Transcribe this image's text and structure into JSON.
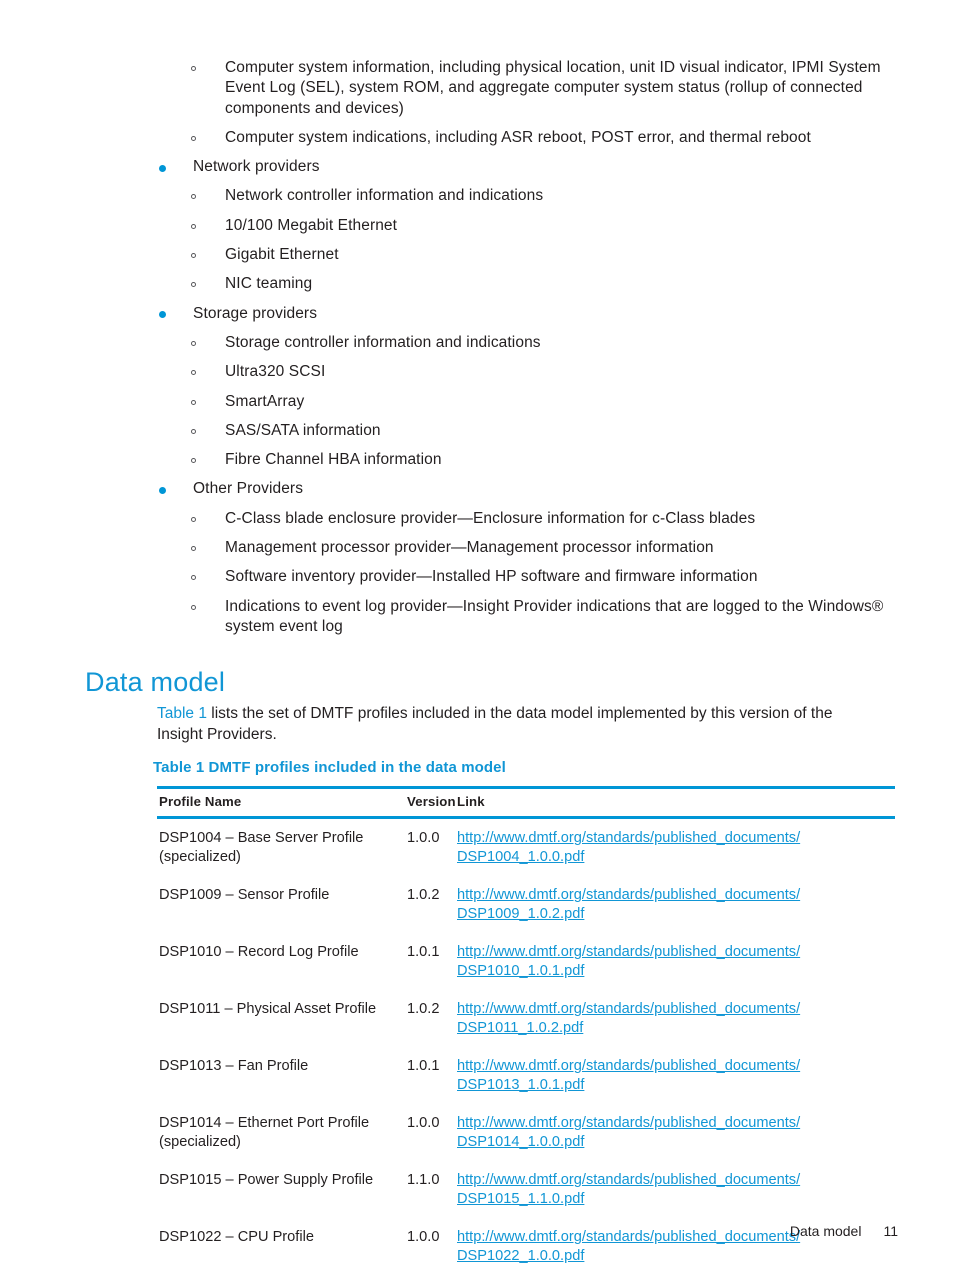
{
  "colors": {
    "accent_blue": "#0096d6",
    "heading_blue": "#1196d5",
    "link_blue": "#1196d5",
    "text": "#231f20",
    "bullet_l2_outline": "#58585b"
  },
  "bullets": [
    {
      "level": 2,
      "text": "Computer system information, including physical location, unit ID visual indicator, IPMI System Event Log (SEL), system ROM, and aggregate computer system status (rollup of connected components and devices)"
    },
    {
      "level": 2,
      "text": "Computer system indications, including ASR reboot, POST error, and thermal reboot"
    },
    {
      "level": 1,
      "text": "Network providers"
    },
    {
      "level": 2,
      "text": "Network controller information and indications"
    },
    {
      "level": 2,
      "text": "10/100 Megabit Ethernet"
    },
    {
      "level": 2,
      "text": "Gigabit Ethernet"
    },
    {
      "level": 2,
      "text": "NIC teaming"
    },
    {
      "level": 1,
      "text": "Storage providers"
    },
    {
      "level": 2,
      "text": "Storage controller information and indications"
    },
    {
      "level": 2,
      "text": "Ultra320 SCSI"
    },
    {
      "level": 2,
      "text": "SmartArray"
    },
    {
      "level": 2,
      "text": "SAS/SATA information"
    },
    {
      "level": 2,
      "text": "Fibre Channel HBA information"
    },
    {
      "level": 1,
      "text": "Other Providers"
    },
    {
      "level": 2,
      "text": "C-Class blade enclosure provider—Enclosure information for c-Class blades"
    },
    {
      "level": 2,
      "text": "Management processor provider—Management processor information"
    },
    {
      "level": 2,
      "text": "Software inventory provider—Installed HP software and firmware information"
    },
    {
      "level": 2,
      "text": "Indications to event log provider—Insight Provider indications that are logged to the Windows® system event log"
    }
  ],
  "heading": {
    "title": "Data model"
  },
  "intro": {
    "xref_label": "Table 1",
    "text_after_xref": " lists the set of DMTF profiles included in the data model implemented by this version of the Insight Providers."
  },
  "table_caption": "Table 1 DMTF profiles included in the data model",
  "table": {
    "columns": [
      "Profile Name",
      "Version",
      "Link"
    ],
    "rows": [
      {
        "name": "DSP1004 – Base Server Profile (specialized)",
        "version": "1.0.0",
        "link_line1": "http://www.dmtf.org/standards/published_documents/",
        "link_line2": "DSP1004_1.0.0.pdf"
      },
      {
        "name": "DSP1009 – Sensor Profile",
        "version": "1.0.2",
        "link_line1": "http://www.dmtf.org/standards/published_documents/",
        "link_line2": "DSP1009_1.0.2.pdf"
      },
      {
        "name": "DSP1010 – Record Log Profile",
        "version": "1.0.1",
        "link_line1": "http://www.dmtf.org/standards/published_documents/",
        "link_line2": "DSP1010_1.0.1.pdf"
      },
      {
        "name": "DSP1011 – Physical Asset Profile",
        "version": "1.0.2",
        "link_line1": "http://www.dmtf.org/standards/published_documents/",
        "link_line2": "DSP1011_1.0.2.pdf"
      },
      {
        "name": "DSP1013 – Fan Profile",
        "version": "1.0.1",
        "link_line1": "http://www.dmtf.org/standards/published_documents/",
        "link_line2": "DSP1013_1.0.1.pdf"
      },
      {
        "name": "DSP1014 – Ethernet Port Profile (specialized)",
        "version": "1.0.0",
        "link_line1": "http://www.dmtf.org/standards/published_documents/",
        "link_line2": "DSP1014_1.0.0.pdf"
      },
      {
        "name": "DSP1015 – Power Supply Profile",
        "version": "1.1.0",
        "link_line1": "http://www.dmtf.org/standards/published_documents/",
        "link_line2": "DSP1015_1.1.0.pdf"
      },
      {
        "name": "DSP1022 – CPU Profile",
        "version": "1.0.0",
        "link_line1": "http://www.dmtf.org/standards/published_documents/",
        "link_line2": "DSP1022_1.0.0.pdf"
      }
    ]
  },
  "footer": {
    "section": "Data model",
    "page_number": "11"
  }
}
